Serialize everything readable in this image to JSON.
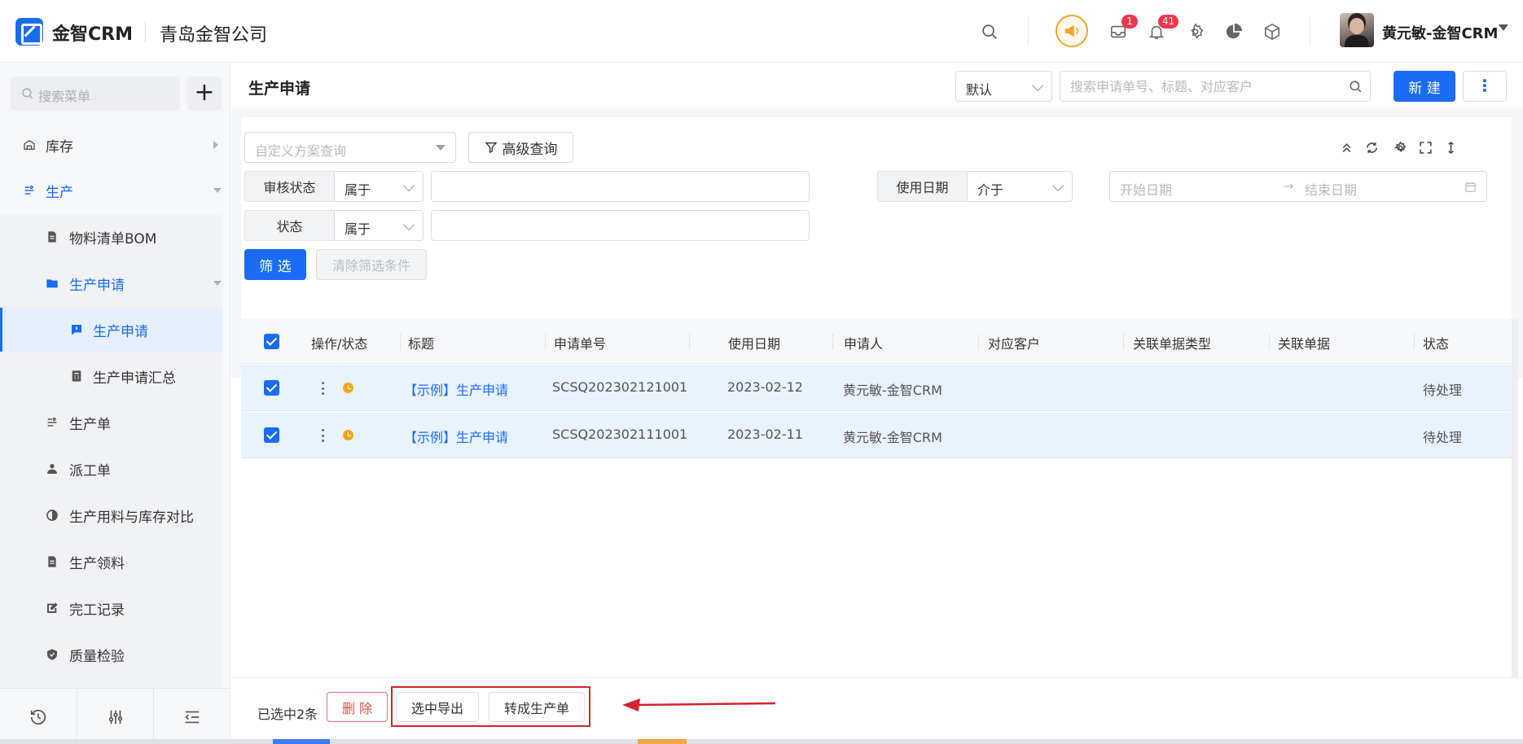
{
  "header": {
    "app_name": "金智CRM",
    "company": "青岛金智公司",
    "user_name": "黄元敏-金智CRM",
    "mail_badge": "1",
    "bell_badge": "41",
    "icons": [
      "search-icon",
      "bullhorn-icon",
      "mail-icon",
      "bell-icon",
      "gear-icon",
      "pie-chart-icon",
      "cube-icon",
      "chevron-down-icon"
    ]
  },
  "sidebar": {
    "search_placeholder": "搜索菜单",
    "add_label": "+",
    "items": [
      {
        "label": "库存",
        "icon": "warehouse-icon"
      },
      {
        "label": "生产",
        "icon": "production-icon"
      },
      {
        "label": "物料清单BOM",
        "icon": "document-icon"
      },
      {
        "label": "生产申请",
        "icon": "folder-icon"
      },
      {
        "label": "生产申请",
        "icon": "message-icon"
      },
      {
        "label": "生产申请汇总",
        "icon": "calculator-icon"
      },
      {
        "label": "生产单",
        "icon": "production-icon"
      },
      {
        "label": "派工单",
        "icon": "worker-icon"
      },
      {
        "label": "生产用料与库存对比",
        "icon": "half-circle-icon"
      },
      {
        "label": "生产领料",
        "icon": "document-icon"
      },
      {
        "label": "完工记录",
        "icon": "edit-icon"
      },
      {
        "label": "质量检验",
        "icon": "shield-icon"
      }
    ],
    "footer_icons": [
      "history-icon",
      "sliders-icon",
      "collapse-menu-icon"
    ]
  },
  "page": {
    "title": "生产申请",
    "view_select": "默认",
    "search_placeholder": "搜索申请单号、标题、对应客户",
    "new_label": "新 建",
    "more_label": "⋮"
  },
  "filters": {
    "plan_placeholder": "自定义方案查询",
    "advanced_label": "高级查询",
    "fields": [
      {
        "label": "审核状态",
        "operator": "属于"
      },
      {
        "label": "使用日期",
        "operator": "介于"
      },
      {
        "label": "状态",
        "operator": "属于"
      }
    ],
    "date_start_placeholder": "开始日期",
    "date_arrow": "→",
    "date_end_placeholder": "结束日期",
    "filter_label": "筛 选",
    "clear_label": "清除筛选条件",
    "toolbar_icons": [
      "collapse-up-icon",
      "refresh-icon",
      "settings-icon",
      "fullscreen-icon",
      "row-height-icon"
    ]
  },
  "table": {
    "columns": [
      "操作/状态",
      "标题",
      "申请单号",
      "使用日期",
      "申请人",
      "对应客户",
      "关联单据类型",
      "关联单据",
      "状态"
    ],
    "rows": [
      {
        "title": "【示例】生产申请",
        "number": "SCSQ202302121001",
        "date": "2023-02-12",
        "applicant": "黄元敏-金智CRM",
        "customer": "",
        "ref_type": "",
        "ref": "",
        "status": "待处理"
      },
      {
        "title": "【示例】生产申请",
        "number": "SCSQ202302111001",
        "date": "2023-02-11",
        "applicant": "黄元敏-金智CRM",
        "customer": "",
        "ref_type": "",
        "ref": "",
        "status": "待处理"
      }
    ]
  },
  "footer": {
    "selected_text": "已选中2条",
    "delete_label": "删 除",
    "export_label": "选中导出",
    "convert_label": "转成生产单"
  },
  "colors": {
    "primary": "#1a6cf5",
    "danger": "#f04848",
    "annotation": "#d5232f",
    "selected_row": "#e9f2ff",
    "badge": "#f5364a",
    "status_pending": "#f7a51c"
  }
}
